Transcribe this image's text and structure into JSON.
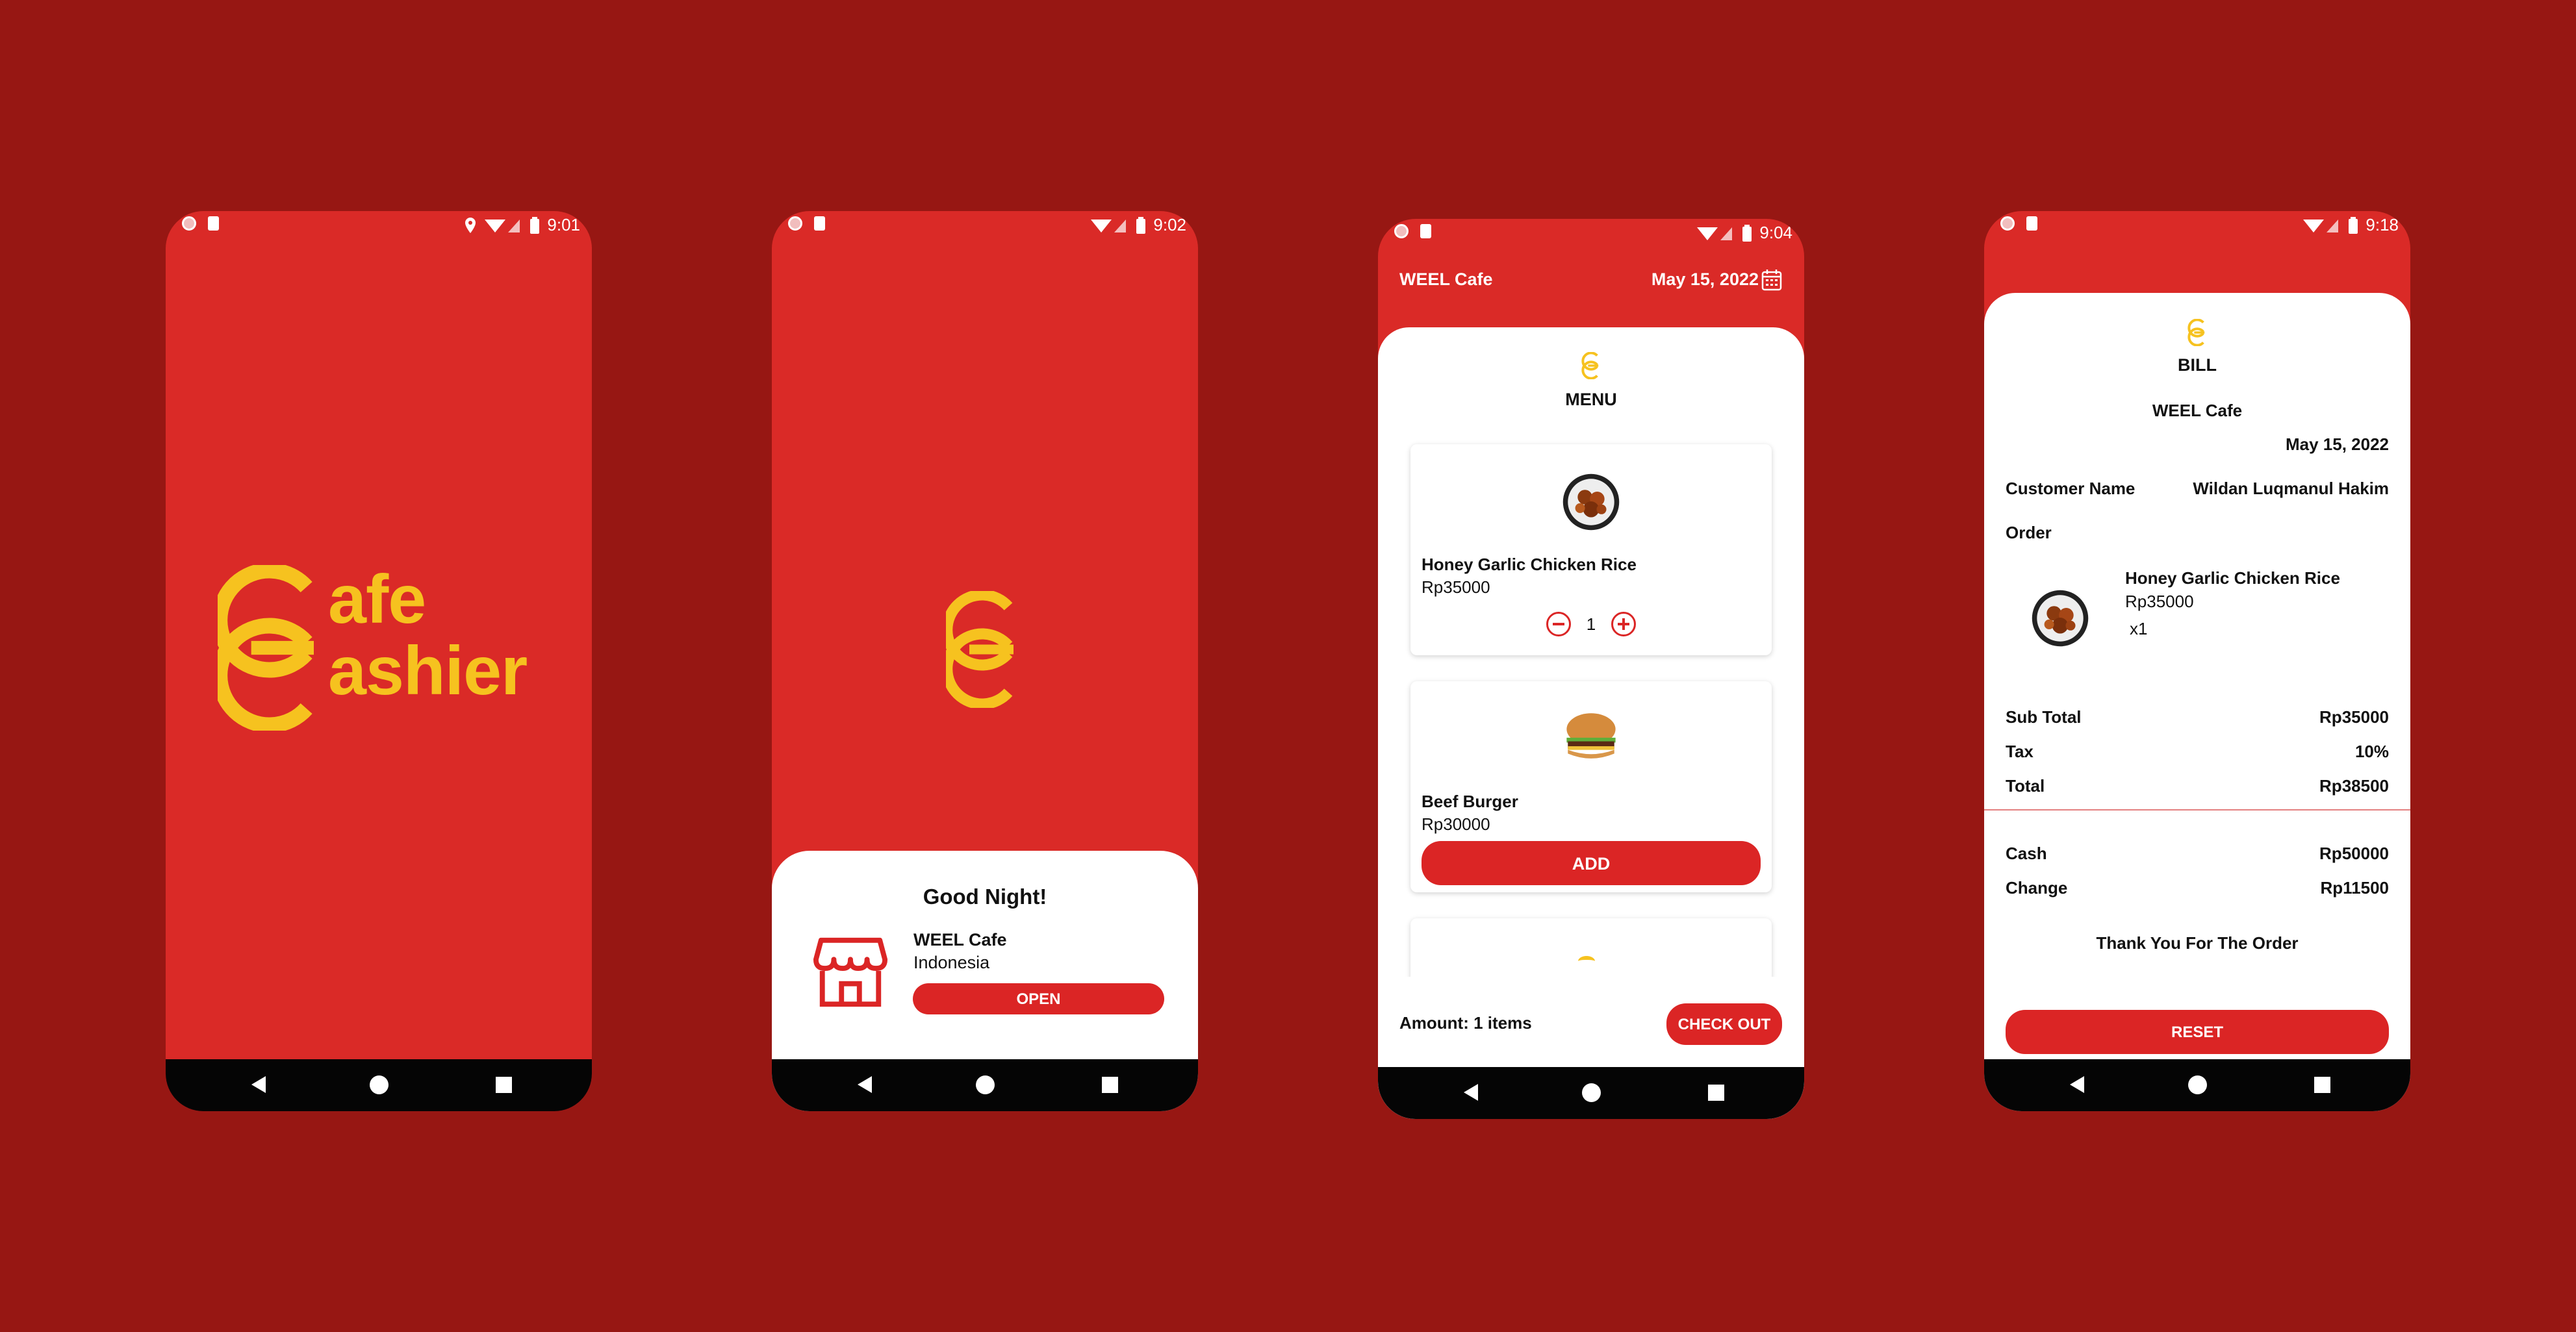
{
  "colors": {
    "background": "#971713",
    "brand_red": "#da2a27",
    "brand_yellow": "#f6c21f",
    "nav_black": "#050505"
  },
  "screens": {
    "splash": {
      "status_time": "9:01",
      "logo_line1": "afe",
      "logo_line2": "ashier"
    },
    "welcome": {
      "status_time": "9:02",
      "greeting": "Good Night!",
      "store_name": "WEEL Cafe",
      "store_country": "Indonesia",
      "open_label": "OPEN",
      "store_icon": "store-icon"
    },
    "menu": {
      "status_time": "9:04",
      "header_title": "WEEL Cafe",
      "header_date": "May 15, 2022",
      "calendar_icon": "calendar-icon",
      "title": "MENU",
      "items": [
        {
          "name": "Honey Garlic Chicken Rice",
          "price": "Rp35000",
          "qty": "1"
        },
        {
          "name": "Beef Burger",
          "price": "Rp30000",
          "add_label": "ADD"
        }
      ],
      "amount_label": "Amount: 1 items",
      "checkout_label": "CHECK OUT"
    },
    "bill": {
      "status_time": "9:18",
      "title": "BILL",
      "cafe_name": "WEEL Cafe",
      "date": "May 15, 2022",
      "customer_label": "Customer Name",
      "customer_value": "Wildan Luqmanul Hakim",
      "order_label": "Order",
      "order_item": {
        "name": "Honey Garlic Chicken Rice",
        "price": "Rp35000",
        "qty": "x1"
      },
      "subtotal_label": "Sub Total",
      "subtotal_value": "Rp35000",
      "tax_label": "Tax",
      "tax_value": "10%",
      "total_label": "Total",
      "total_value": "Rp38500",
      "cash_label": "Cash",
      "cash_value": "Rp50000",
      "change_label": "Change",
      "change_value": "Rp11500",
      "thanks": "Thank You For The Order",
      "reset_label": "RESET"
    }
  }
}
